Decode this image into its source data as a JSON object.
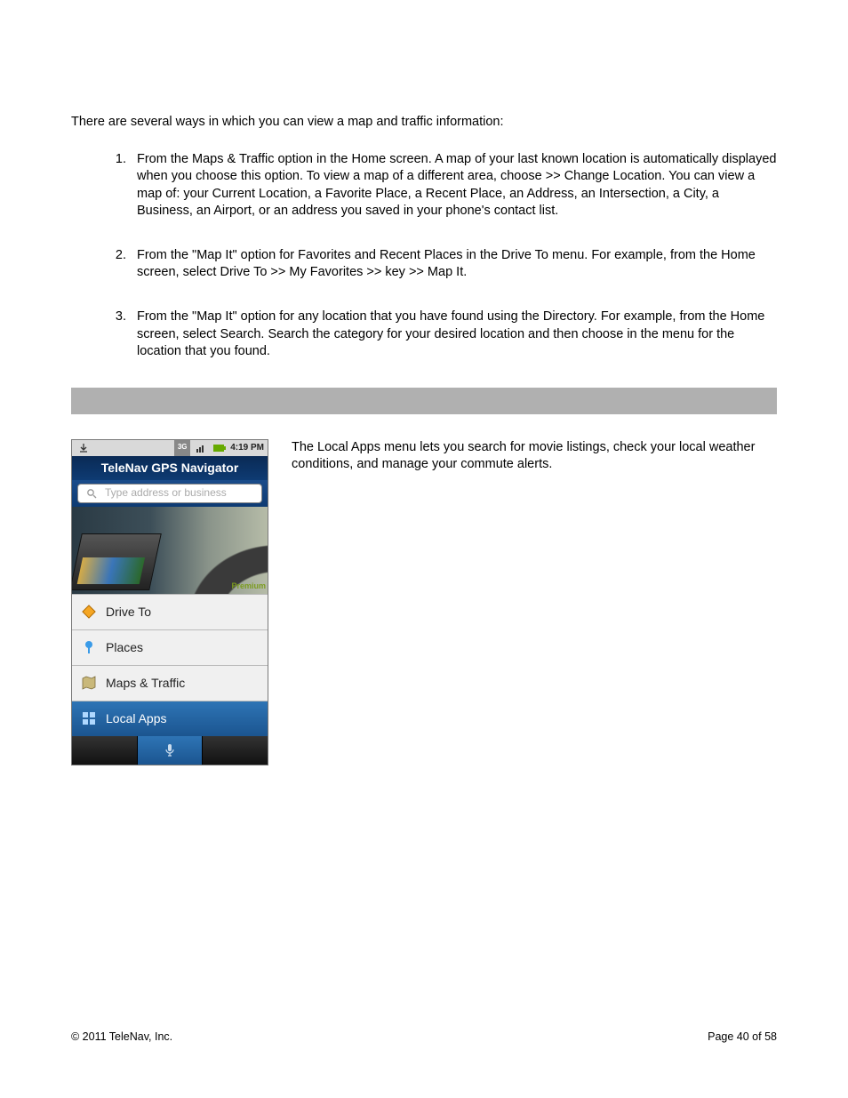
{
  "intro": "There are several ways in which you can view a map and traffic information:",
  "items": [
    {
      "num": "1.",
      "text": "From the Maps & Traffic option in the Home screen. A map of your last known location is automatically displayed when you choose this option. To view a map of a different area, choose           >> Change Location. You can view a map of: your Current Location, a Favorite Place, a Recent Place, an Address, an Intersection, a City, a Business, an Airport, or an address you saved in your phone's contact list."
    },
    {
      "num": "2.",
      "text": "From the \"Map It\" option for Favorites and Recent Places in the Drive To menu. For example, from the Home screen, select Drive To >> My Favorites >>           key >> Map It."
    },
    {
      "num": "3.",
      "text": "From the \"Map It\" option for any location that you have found using the Directory. For example, from the Home screen, select Search. Search the category for your desired location and then choose            in the menu for the location that you found."
    }
  ],
  "phone": {
    "time": "4:19 PM",
    "title": "TeleNav GPS Navigator",
    "search_placeholder": "Type address or business",
    "premium": "Premium",
    "menu": {
      "drive_to": "Drive To",
      "places": "Places",
      "maps_traffic": "Maps & Traffic",
      "local_apps": "Local Apps"
    }
  },
  "side_text": "The Local Apps menu lets you search for movie listings, check your local weather conditions, and manage your commute alerts.",
  "footer": {
    "copyright": "© 2011 TeleNav, Inc.",
    "page": "Page 40 of 58"
  }
}
